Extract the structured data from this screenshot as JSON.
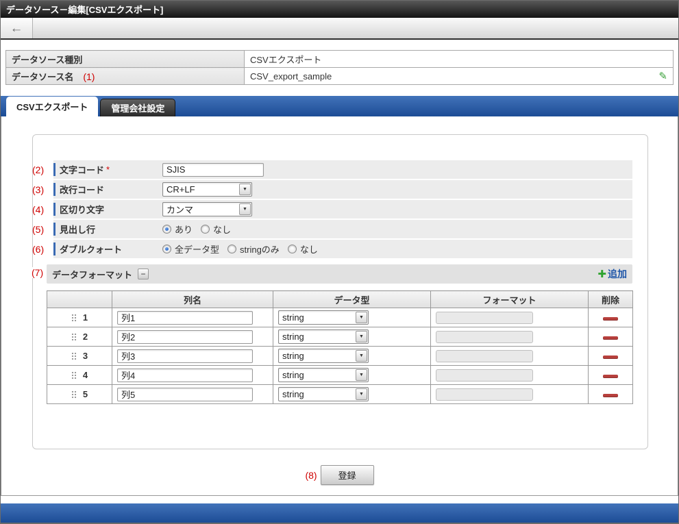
{
  "title_bar": {
    "title": "データソース－編集[CSVエクスポート]"
  },
  "icons": {
    "back": "←",
    "pencil": "✎",
    "dropdown": "▼",
    "plus": "✚",
    "minus_toggle": "−"
  },
  "info_table": {
    "rows": [
      {
        "label": "データソース種別",
        "annotation": "",
        "value": "CSVエクスポート"
      },
      {
        "label": "データソース名",
        "annotation": "(1)",
        "value": "CSV_export_sample"
      }
    ]
  },
  "tabs": [
    {
      "label": "CSVエクスポート"
    },
    {
      "label": "管理会社設定"
    }
  ],
  "form": {
    "fields": [
      {
        "num": "(2)",
        "label": "文字コード",
        "required": "*",
        "value": "SJIS"
      },
      {
        "num": "(3)",
        "label": "改行コード",
        "value": "CR+LF"
      },
      {
        "num": "(4)",
        "label": "区切り文字",
        "value": "カンマ"
      },
      {
        "num": "(5)",
        "label": "見出し行",
        "options": [
          {
            "label": "あり"
          },
          {
            "label": "なし"
          }
        ]
      },
      {
        "num": "(6)",
        "label": "ダブルクォート",
        "options": [
          {
            "label": "全データ型"
          },
          {
            "label": "stringのみ"
          },
          {
            "label": "なし"
          }
        ]
      }
    ]
  },
  "format_section": {
    "num": "(7)",
    "title": "データフォーマット",
    "add_label": "追加",
    "table": {
      "headers": [
        "",
        "列名",
        "データ型",
        "フォーマット",
        "削除"
      ],
      "rows": [
        {
          "index": "1",
          "name": "列1",
          "type": "string"
        },
        {
          "index": "2",
          "name": "列2",
          "type": "string"
        },
        {
          "index": "3",
          "name": "列3",
          "type": "string"
        },
        {
          "index": "4",
          "name": "列4",
          "type": "string"
        },
        {
          "index": "5",
          "name": "列5",
          "type": "string"
        }
      ]
    }
  },
  "submit": {
    "num": "(8)",
    "label": "登録"
  },
  "colors": {
    "accent_blue": "#2a5ba8",
    "annotation_red": "#cf0000",
    "add_green": "#2fa32f",
    "link_blue": "#1d55a8",
    "delete_red": "#b8403d",
    "pencil_green": "#3aa03a"
  }
}
